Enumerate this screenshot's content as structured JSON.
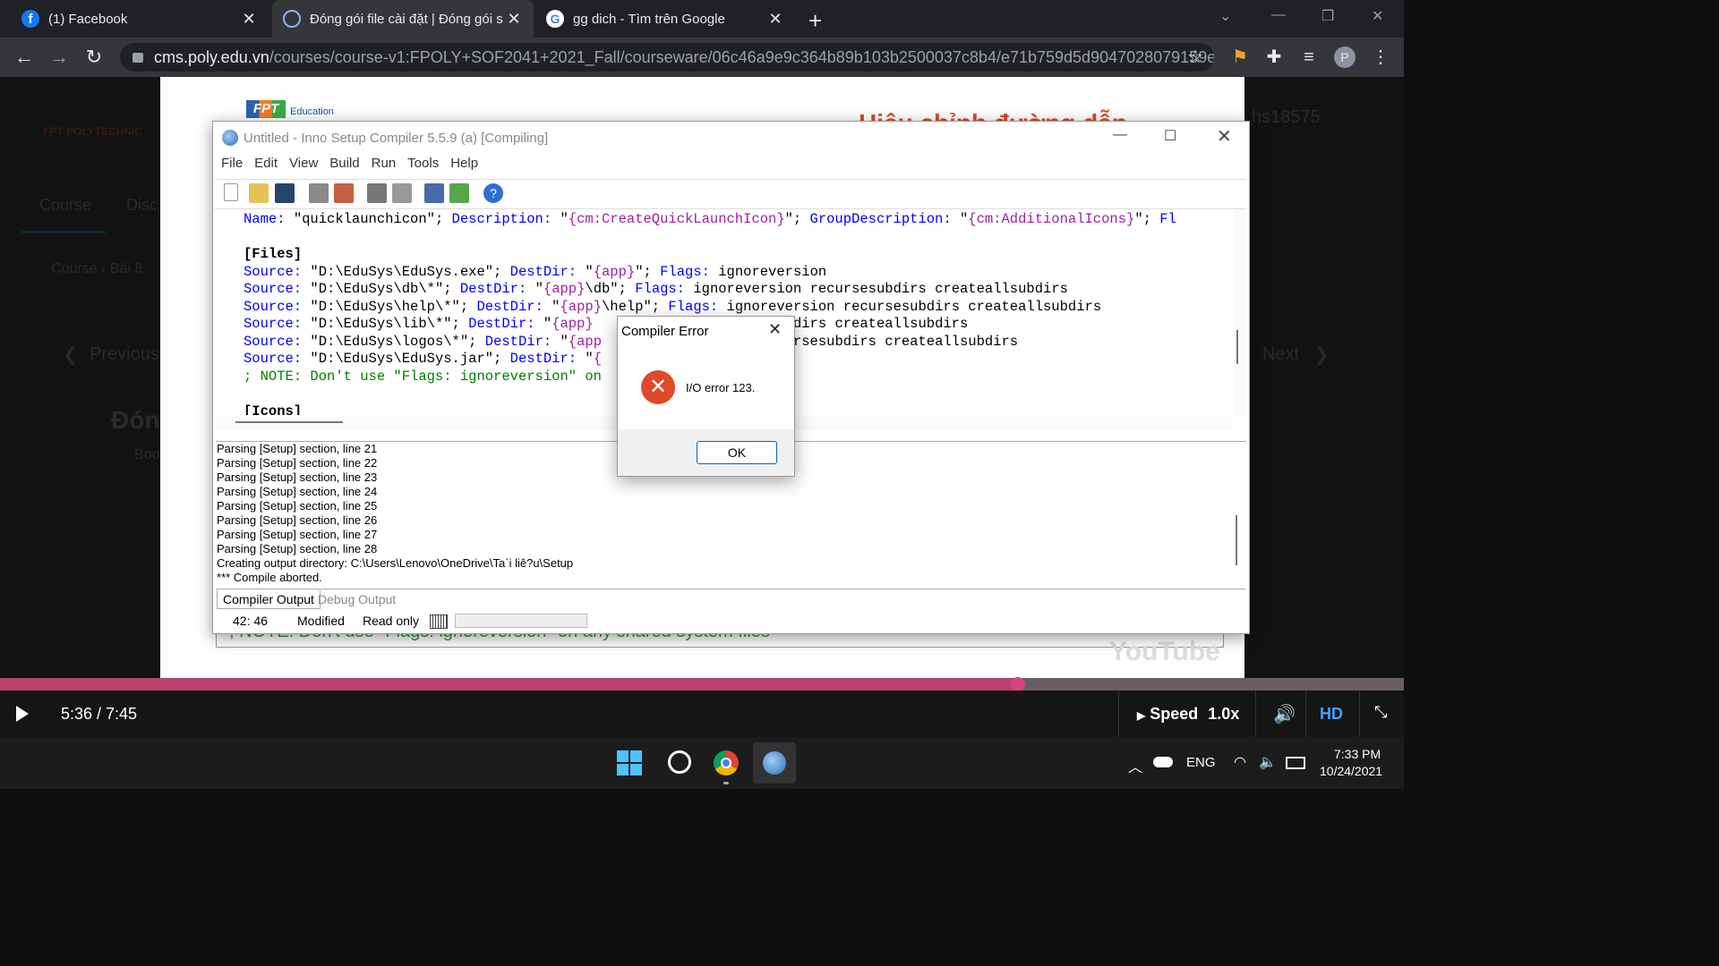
{
  "browser": {
    "tabs": [
      {
        "title": "(1) Facebook",
        "icon": "facebook-icon"
      },
      {
        "title": "Đóng gói file cài đặt | Đóng gói s",
        "icon": "loading-icon",
        "active": true
      },
      {
        "title": "gg dich - Tìm trên Google",
        "icon": "google-icon"
      }
    ],
    "url_host": "cms.poly.edu.vn",
    "url_path": "/courses/course-v1:FPOLY+SOF2041+2021_Fall/courseware/06c46a9e9c364b89b103b2500037c8b4/e71b759d5d9047028079159e6d...",
    "profile_initial": "P"
  },
  "background_page": {
    "brand": "FPT POLYTECHNIC",
    "nav": [
      "Course",
      "Disc"
    ],
    "breadcrumb": "Course  ›  Bài 8",
    "prev_label": "Previous",
    "next_label": "Next",
    "heading": "Đón",
    "bookmark": "Boo",
    "username": "hs18575"
  },
  "slide": {
    "logo_text": "FPT",
    "logo_sub": "Education",
    "title_partial": "Hiệu chỉnh đường dẫn",
    "footer_note": "; NOTE: Don't use \"Flags: ignoreversion\" on any shared system files",
    "youtube": "YouTube"
  },
  "inno": {
    "title": "Untitled - Inno Setup Compiler 5.5.9 (a)  [Compiling]",
    "menu": [
      "File",
      "Edit",
      "View",
      "Build",
      "Run",
      "Tools",
      "Help"
    ],
    "code_lines": [
      [
        [
          "kw",
          "Name: "
        ],
        [
          "str",
          "\"quicklaunchicon\"; "
        ],
        [
          "kw",
          "Description: "
        ],
        [
          "str",
          "\""
        ],
        [
          "cst",
          "{cm:CreateQuickLaunchIcon}"
        ],
        [
          "str",
          "\"; "
        ],
        [
          "kw",
          "GroupDescription: "
        ],
        [
          "str",
          "\""
        ],
        [
          "cst",
          "{cm:AdditionalIcons}"
        ],
        [
          "str",
          "\"; "
        ],
        [
          "kw",
          "Fl"
        ]
      ],
      [
        [
          "str",
          ""
        ]
      ],
      [
        [
          "sec",
          "[Files]"
        ]
      ],
      [
        [
          "kw",
          "Source: "
        ],
        [
          "str",
          "\"D:\\EduSys\\EduSys.exe\"; "
        ],
        [
          "kw",
          "DestDir: "
        ],
        [
          "str",
          "\""
        ],
        [
          "cst",
          "{app}"
        ],
        [
          "str",
          "\"; "
        ],
        [
          "kw",
          "Flags: "
        ],
        [
          "str",
          "ignoreversion"
        ]
      ],
      [
        [
          "kw",
          "Source: "
        ],
        [
          "str",
          "\"D:\\EduSys\\db\\*\"; "
        ],
        [
          "kw",
          "DestDir: "
        ],
        [
          "str",
          "\""
        ],
        [
          "cst",
          "{app}"
        ],
        [
          "str",
          "\\db\"; "
        ],
        [
          "kw",
          "Flags: "
        ],
        [
          "str",
          "ignoreversion recursesubdirs createallsubdirs"
        ]
      ],
      [
        [
          "kw",
          "Source: "
        ],
        [
          "str",
          "\"D:\\EduSys\\help\\*\"; "
        ],
        [
          "kw",
          "DestDir: "
        ],
        [
          "str",
          "\""
        ],
        [
          "cst",
          "{app}"
        ],
        [
          "str",
          "\\help\"; "
        ],
        [
          "kw",
          "Flags: "
        ],
        [
          "str",
          "ignoreversion recursesubdirs createallsubdirs"
        ]
      ],
      [
        [
          "kw",
          "Source: "
        ],
        [
          "str",
          "\"D:\\EduSys\\lib\\*\"; "
        ],
        [
          "kw",
          "DestDir: "
        ],
        [
          "str",
          "\""
        ],
        [
          "cst",
          "{app}"
        ],
        [
          "str",
          "       ersion recursesubdirs createallsubdirs"
        ]
      ],
      [
        [
          "kw",
          "Source: "
        ],
        [
          "str",
          "\"D:\\EduSys\\logos\\*\"; "
        ],
        [
          "kw",
          "DestDir: "
        ],
        [
          "str",
          "\""
        ],
        [
          "cst",
          "{app"
        ],
        [
          "str",
          "        oreversion recursesubdirs createallsubdirs"
        ]
      ],
      [
        [
          "kw",
          "Source: "
        ],
        [
          "str",
          "\"D:\\EduSys\\EduSys.jar\"; "
        ],
        [
          "kw",
          "DestDir: "
        ],
        [
          "str",
          "\""
        ],
        [
          "cst",
          "{"
        ],
        [
          "str",
          "            version"
        ]
      ],
      [
        [
          "cmt",
          "; NOTE: Don't use \"Flags: ignoreversion\" on             iles"
        ]
      ],
      [
        [
          "str",
          ""
        ]
      ],
      [
        [
          "sec",
          "[Icons]"
        ]
      ]
    ],
    "output_lines": [
      "Parsing [Setup] section, line 21",
      "Parsing [Setup] section, line 22",
      "Parsing [Setup] section, line 23",
      "Parsing [Setup] section, line 24",
      "Parsing [Setup] section, line 25",
      "Parsing [Setup] section, line 26",
      "Parsing [Setup] section, line 27",
      "Parsing [Setup] section, line 28",
      "Creating output directory: C:\\Users\\Lenovo\\OneDrive\\Ta`i liê?u\\Setup",
      "*** Compile aborted."
    ],
    "output_tabs": [
      "Compiler Output",
      "Debug Output"
    ],
    "status": {
      "position": "42:  46",
      "modified": "Modified",
      "readonly": "Read only"
    }
  },
  "dialog": {
    "title": "Compiler Error",
    "message": "I/O error 123.",
    "ok": "OK",
    "error_color": "#e0492a"
  },
  "player": {
    "time": "5:36 / 7:45",
    "speed_label": "Speed",
    "speed_value": "1.0x",
    "quality": "HD",
    "progress_fraction": 0.725
  },
  "taskbar": {
    "lang": "ENG",
    "time": "7:33 PM",
    "date": "10/24/2021"
  }
}
